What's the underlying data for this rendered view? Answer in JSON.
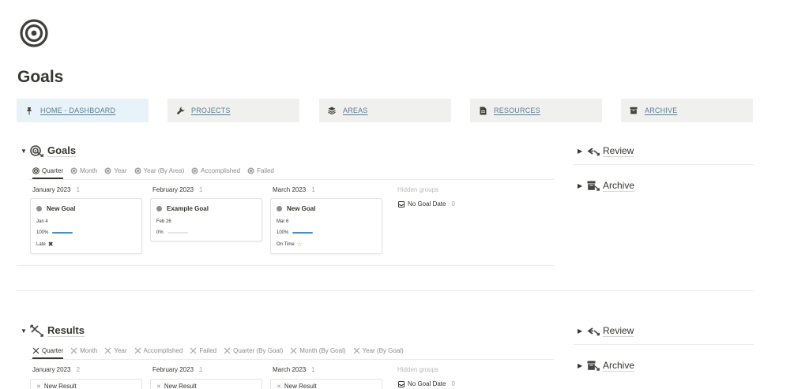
{
  "page": {
    "title": "Goals",
    "icon": "target-icon"
  },
  "nav": [
    {
      "label": "HOME - DASHBOARD",
      "icon": "pin-icon",
      "active": true
    },
    {
      "label": "PROJECTS",
      "icon": "wrench-icon",
      "active": false
    },
    {
      "label": "AREAS",
      "icon": "layers-icon",
      "active": false
    },
    {
      "label": "RESOURCES",
      "icon": "document-icon",
      "active": false
    },
    {
      "label": "ARCHIVE",
      "icon": "archive-box-icon",
      "active": false
    }
  ],
  "goals": {
    "title": "Goals",
    "icon": "goal-target-arrow-icon",
    "tabs": [
      {
        "label": "Quarter",
        "active": true
      },
      {
        "label": "Month",
        "active": false
      },
      {
        "label": "Year",
        "active": false
      },
      {
        "label": "Year (By Area)",
        "active": false
      },
      {
        "label": "Accomplished",
        "active": false
      },
      {
        "label": "Failed",
        "active": false
      }
    ],
    "groups": [
      {
        "name": "January 2023",
        "count": "1",
        "card": {
          "title": "New Goal",
          "date": "Jan 4",
          "progress": "100%",
          "progress_value": 1.0,
          "status": "Late",
          "status_icon": "cross-swords-icon"
        }
      },
      {
        "name": "February 2023",
        "count": "1",
        "card": {
          "title": "Example Goal",
          "date": "Feb 26",
          "progress": "0%",
          "progress_value": 0.0,
          "status": "",
          "status_icon": ""
        }
      },
      {
        "name": "March 2023",
        "count": "1",
        "card": {
          "title": "New Goal",
          "date": "Mar 6",
          "progress": "100%",
          "progress_value": 1.0,
          "status": "On Time",
          "status_icon": "star-icon"
        }
      }
    ],
    "hidden_groups_label": "Hidden groups",
    "no_goal_date": {
      "label": "No Goal Date",
      "count": "0"
    }
  },
  "goals_side": [
    {
      "title": "Review",
      "icon": "review-arrows-icon"
    },
    {
      "title": "Archive",
      "icon": "archive-icon"
    }
  ],
  "results": {
    "title": "Results",
    "icon": "results-arrows-icon",
    "tabs": [
      {
        "label": "Quarter",
        "active": true
      },
      {
        "label": "Month",
        "active": false
      },
      {
        "label": "Year",
        "active": false
      },
      {
        "label": "Accomplished",
        "active": false
      },
      {
        "label": "Failed",
        "active": false
      },
      {
        "label": "Quarter (By Goal)",
        "active": false
      },
      {
        "label": "Month (By Goal)",
        "active": false
      },
      {
        "label": "Year (By Goal)",
        "active": false
      }
    ],
    "groups": [
      {
        "name": "January 2023",
        "count": "2",
        "card_title": "New Result"
      },
      {
        "name": "February 2023",
        "count": "1",
        "card_title": "New Result"
      },
      {
        "name": "March 2023",
        "count": "1",
        "card_title": "New Result"
      }
    ],
    "hidden_groups_label": "Hidden groups",
    "no_goal_date": {
      "label": "No Goal Date",
      "count": "0"
    }
  },
  "results_side": [
    {
      "title": "Review",
      "icon": "review-arrows-icon"
    },
    {
      "title": "Archive",
      "icon": "archive-icon"
    }
  ]
}
